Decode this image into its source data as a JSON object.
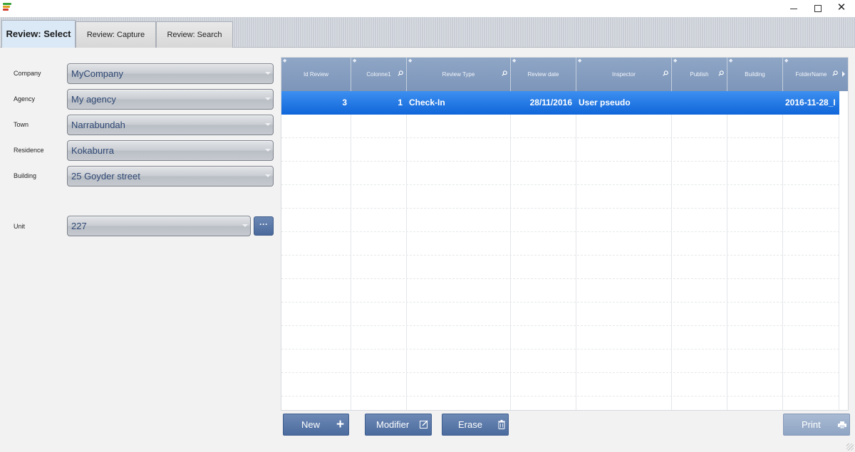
{
  "window": {
    "controls": {
      "minimize_icon": "minimize-icon",
      "maximize_icon": "maximize-icon",
      "close_glyph": "✕"
    }
  },
  "tabs": [
    {
      "label": "Review: Select",
      "active": true
    },
    {
      "label": "Review: Capture",
      "active": false
    },
    {
      "label": "Review: Search",
      "active": false
    }
  ],
  "filters": {
    "company": {
      "label": "Company",
      "value": "MyCompany"
    },
    "agency": {
      "label": "Agency",
      "value": "My agency"
    },
    "town": {
      "label": "Town",
      "value": "Narrabundah"
    },
    "residence": {
      "label": "Residence",
      "value": "Kokaburra"
    },
    "building": {
      "label": "Building",
      "value": "25 Goyder street"
    },
    "unit": {
      "label": "Unit",
      "value": "227",
      "more_button": "···"
    }
  },
  "grid": {
    "columns": [
      "Id Review",
      "Colonne1",
      "Review Type",
      "Review date",
      "Inspector",
      "Publish",
      "Building",
      "FolderName"
    ],
    "rows": [
      {
        "id_review": "3",
        "colonne1": "1",
        "review_type": "Check-In",
        "review_date": "28/11/2016",
        "inspector": "User pseudo",
        "publish": "",
        "building": "",
        "folder_name": "2016-11-28_I"
      }
    ]
  },
  "buttons": {
    "new": "New",
    "modifier": "Modifier",
    "erase": "Erase",
    "print": "Print"
  },
  "colors": {
    "accent": "#4b6b9e",
    "selected_row": "#1a6fe0",
    "header": "#8aa1c2"
  }
}
